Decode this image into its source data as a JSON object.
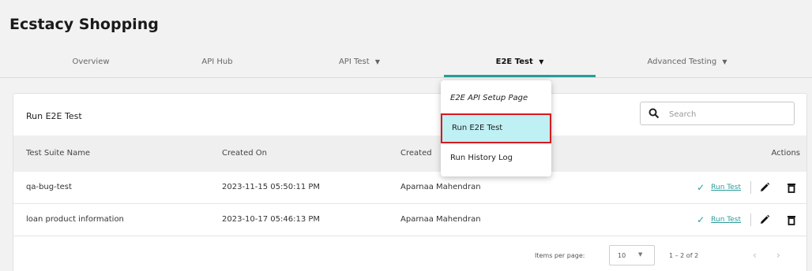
{
  "app": {
    "title": "Ecstacy Shopping"
  },
  "tabs": [
    {
      "label": "Overview",
      "caret": ""
    },
    {
      "label": "API Hub",
      "caret": ""
    },
    {
      "label": "API Test",
      "caret": "▼"
    },
    {
      "label": "E2E Test",
      "caret": "▼"
    },
    {
      "label": "Advanced Testing",
      "caret": "▼"
    }
  ],
  "dropdown": {
    "items": [
      {
        "label": "E2E API Setup Page"
      },
      {
        "label": "Run E2E Test"
      },
      {
        "label": "Run History Log"
      }
    ]
  },
  "card": {
    "title": "Run E2E Test",
    "search": {
      "placeholder": "Search"
    }
  },
  "table": {
    "headers": {
      "name": "Test Suite Name",
      "created_on": "Created On",
      "created_by": "Created",
      "actions": "Actions"
    },
    "rows": [
      {
        "name": "qa-bug-test",
        "created_on": "2023-11-15 05:50:11 PM",
        "created_by": "Aparnaa Mahendran",
        "run": "Run Test"
      },
      {
        "name": "loan product information",
        "created_on": "2023-10-17 05:46:13 PM",
        "created_by": "Aparnaa Mahendran",
        "run": "Run Test"
      }
    ]
  },
  "pagination": {
    "items_per_page_label": "Items per page:",
    "page_size": "10",
    "range": "1 – 2 of 2"
  },
  "colors": {
    "accent": "#2a9d9a",
    "highlight": "#bff0f3",
    "outline": "#d71920"
  }
}
